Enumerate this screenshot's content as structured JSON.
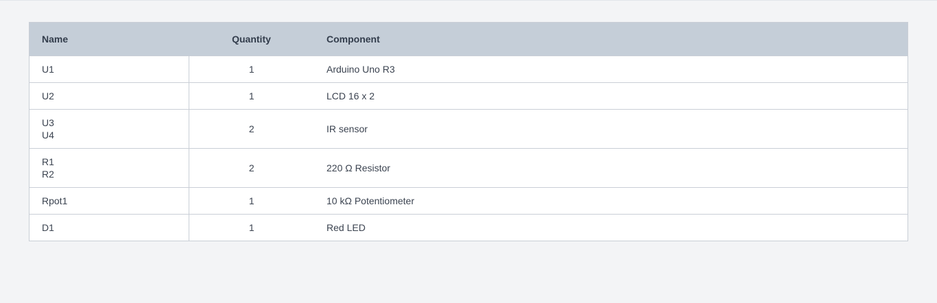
{
  "table": {
    "headers": {
      "name": "Name",
      "quantity": "Quantity",
      "component": "Component"
    },
    "rows": [
      {
        "names": [
          "U1"
        ],
        "quantity": "1",
        "component": "Arduino Uno R3"
      },
      {
        "names": [
          "U2"
        ],
        "quantity": "1",
        "component": "LCD 16 x 2"
      },
      {
        "names": [
          "U3",
          "U4"
        ],
        "quantity": "2",
        "component": "IR sensor"
      },
      {
        "names": [
          "R1",
          "R2"
        ],
        "quantity": "2",
        "component": "220 Ω Resistor"
      },
      {
        "names": [
          "Rpot1"
        ],
        "quantity": "1",
        "component": "10 kΩ Potentiometer"
      },
      {
        "names": [
          "D1"
        ],
        "quantity": "1",
        "component": "Red LED"
      }
    ]
  }
}
